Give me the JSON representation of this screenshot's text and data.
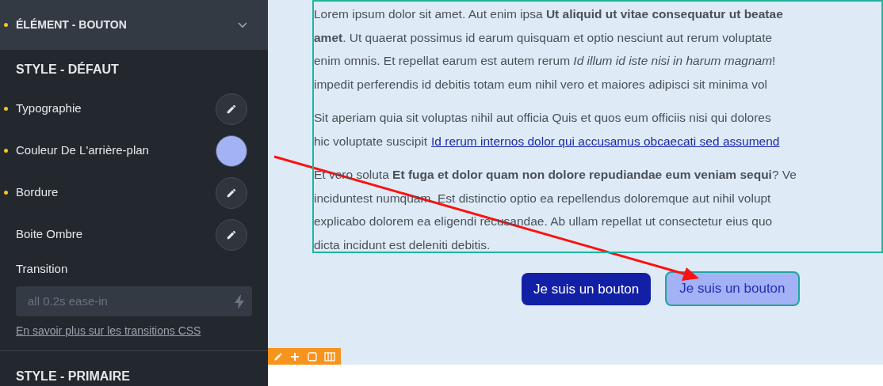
{
  "sidebar": {
    "section": {
      "title": "ÉLÉMENT - BOUTON",
      "modified": true,
      "expanded": false
    },
    "group_title": "STYLE - DÉFAUT",
    "properties": [
      {
        "label": "Typographie",
        "modified": true,
        "kind": "edit"
      },
      {
        "label": "Couleur De L'arrière-plan",
        "modified": true,
        "kind": "color",
        "color": "#a3b1f5"
      },
      {
        "label": "Bordure",
        "modified": true,
        "kind": "edit"
      },
      {
        "label": "Boite Ombre",
        "modified": false,
        "kind": "edit"
      }
    ],
    "transition": {
      "label": "Transition",
      "placeholder": "all 0.2s ease-in"
    },
    "help_link": "En savoir plus sur les transitions CSS",
    "next_group_title": "STYLE - PRIMAIRE"
  },
  "canvas": {
    "paragraphs": [
      [
        {
          "text": "Lorem ipsum dolor sit amet. Aut enim ipsa **Ut aliquid ut vitae consequatur ut beatae**"
        },
        {
          "text": "**amet**. Ut quaerat possimus id earum quisquam et optio nesciunt aut rerum voluptate"
        },
        {
          "text": "enim omnis. Et repellat earum est autem rerum *Id illum id iste nisi in harum magnam*!"
        },
        {
          "text": "impedit perferendis id debitis totam eum nihil vero et maiores adipisci sit minima vol"
        }
      ],
      [
        {
          "text": "Sit aperiam quia sit voluptas nihil aut officia Quis et quos eum officiis nisi qui dolores"
        },
        {
          "text": "hic voluptate suscipit",
          "link": "Id rerum internos dolor qui accusamus obcaecati sed assumend"
        }
      ],
      [
        {
          "text": "Et vero soluta **Et fuga et dolor quam non dolore repudiandae eum veniam sequi**? Ve"
        },
        {
          "text": "inciduntest numquam. Est distinctio optio ea repellendus doloremque aut nihil volupt"
        },
        {
          "text": "explicabo dolorem ea eligendi recusandae. Ab ullam repellat ut consectetur eius quo"
        },
        {
          "text": "dicta incidunt est deleniti debitis."
        }
      ]
    ],
    "buttons": [
      {
        "label": "Je suis un bouton",
        "kind": "default"
      },
      {
        "label": "Je suis un bouton",
        "kind": "preview"
      }
    ]
  }
}
